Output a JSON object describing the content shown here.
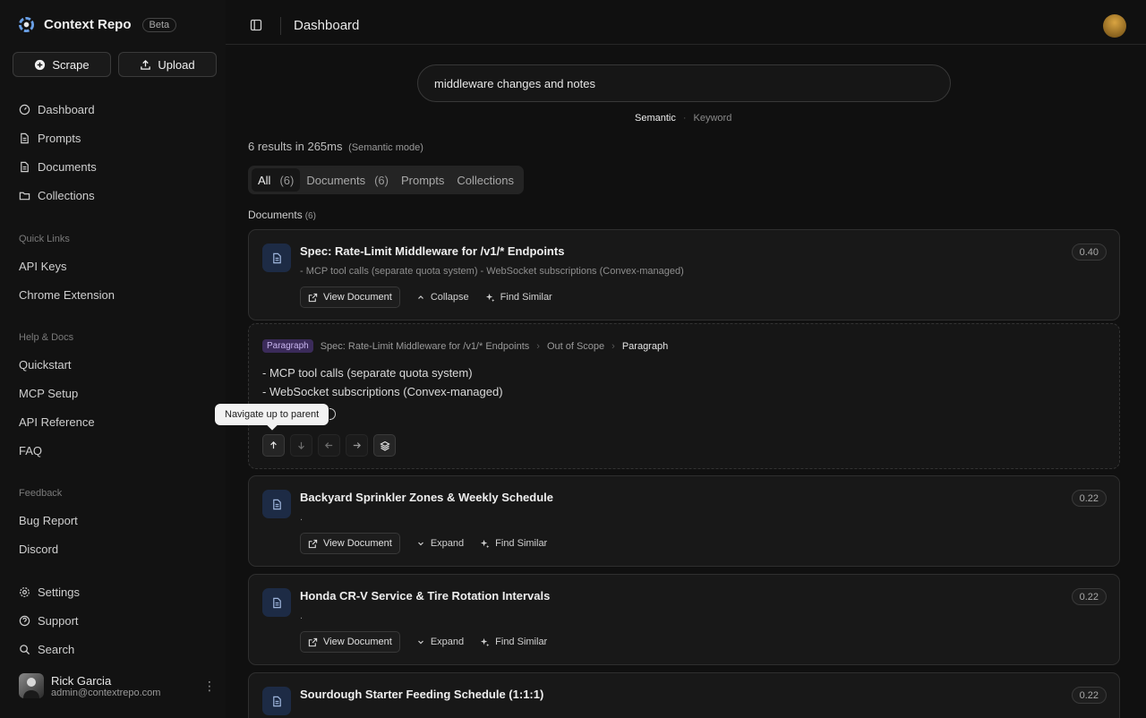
{
  "app": {
    "name": "Context Repo",
    "badge": "Beta"
  },
  "sidebar": {
    "scrape_label": "Scrape",
    "upload_label": "Upload",
    "main_nav": [
      {
        "label": "Dashboard",
        "icon": "dashboard-icon"
      },
      {
        "label": "Prompts",
        "icon": "file-icon"
      },
      {
        "label": "Documents",
        "icon": "file-icon"
      },
      {
        "label": "Collections",
        "icon": "folder-icon"
      }
    ],
    "quick_links_title": "Quick Links",
    "quick_links": [
      "API Keys",
      "Chrome Extension"
    ],
    "help_title": "Help & Docs",
    "help_links": [
      "Quickstart",
      "MCP Setup",
      "API Reference",
      "FAQ"
    ],
    "feedback_title": "Feedback",
    "feedback_links": [
      "Bug Report",
      "Discord"
    ],
    "bottom_nav": [
      {
        "label": "Settings",
        "icon": "gear-icon"
      },
      {
        "label": "Support",
        "icon": "help-circle-icon"
      },
      {
        "label": "Search",
        "icon": "search-icon"
      }
    ],
    "user": {
      "name": "Rick Garcia",
      "email": "admin@contextrepo.com"
    }
  },
  "header": {
    "title": "Dashboard"
  },
  "search": {
    "query": "middleware changes and notes",
    "mode_semantic": "Semantic",
    "mode_separator": "·",
    "mode_keyword": "Keyword"
  },
  "results": {
    "summary": "6 results in 265ms",
    "mode_note": "(Semantic mode)",
    "tabs": [
      {
        "label": "All",
        "count": "(6)"
      },
      {
        "label": "Documents",
        "count": "(6)"
      },
      {
        "label": "Prompts",
        "count": ""
      },
      {
        "label": "Collections",
        "count": ""
      }
    ],
    "section_title": "Documents",
    "section_count": "(6)"
  },
  "actions": {
    "view": "View Document",
    "collapse": "Collapse",
    "expand": "Expand",
    "similar": "Find Similar"
  },
  "cards": [
    {
      "title": "Spec: Rate-Limit Middleware for /v1/* Endpoints",
      "snippet": "- MCP tool calls (separate quota system) - WebSocket subscriptions (Convex-managed)",
      "score": "0.40"
    },
    {
      "title": "Backyard Sprinkler Zones & Weekly Schedule",
      "snippet": ".",
      "score": "0.22"
    },
    {
      "title": "Honda CR-V Service & Tire Rotation Intervals",
      "snippet": ".",
      "score": "0.22"
    },
    {
      "title": "Sourdough Starter Feeding Schedule (1:1:1)",
      "snippet": "",
      "score": "0.22"
    }
  ],
  "paragraph": {
    "badge": "Paragraph",
    "crumbs": [
      "Spec: Rate-Limit Middleware for /v1/* Endpoints",
      "Out of Scope",
      "Paragraph"
    ],
    "lines": [
      "- MCP tool calls (separate quota system)",
      "- WebSocket subscriptions (Convex-managed)"
    ],
    "tooltip": "Navigate up to parent"
  }
}
